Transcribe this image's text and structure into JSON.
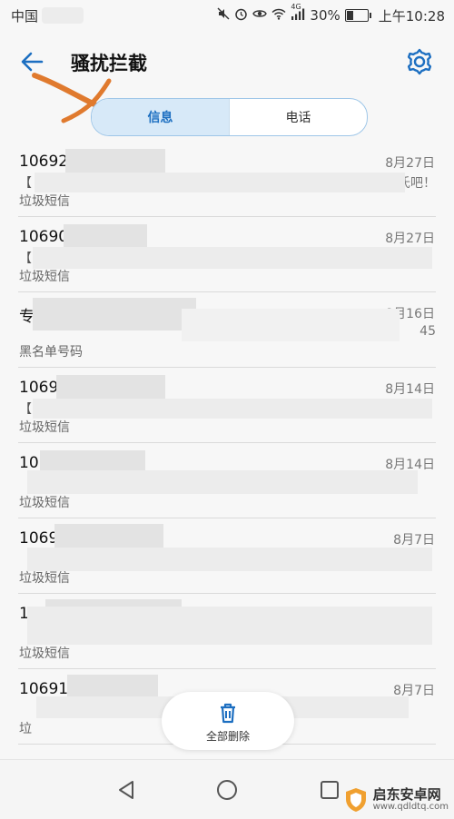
{
  "status_bar": {
    "carrier": "中国",
    "network": "4G",
    "battery_percent": "30%",
    "time": "上午10:28",
    "battery_level": 0.3
  },
  "app_bar": {
    "title": "骚扰拦截",
    "back_icon": "arrow-left-icon",
    "settings_icon": "gear-icon"
  },
  "tabs": [
    {
      "label": "信息",
      "selected": true
    },
    {
      "label": "电话",
      "selected": false
    }
  ],
  "messages": [
    {
      "sender": "10692",
      "date": "8月27日",
      "snippet": "【",
      "snippet_tail": "氏吧！",
      "category": "垃圾短信"
    },
    {
      "sender": "10690",
      "date": "8月27日",
      "snippet": "【",
      "snippet_tail": "",
      "category": "垃圾短信"
    },
    {
      "sender": "专",
      "date": "8月16日",
      "snippet": "",
      "snippet_tail": "45",
      "category": "黑名单号码"
    },
    {
      "sender": "1069",
      "date": "8月14日",
      "snippet": "【",
      "snippet_tail": "",
      "category": "垃圾短信"
    },
    {
      "sender": "10",
      "date": "8月14日",
      "snippet": "",
      "snippet_tail": "",
      "category": "垃圾短信"
    },
    {
      "sender": "1069",
      "date": "8月7日",
      "snippet": "",
      "snippet_tail": "",
      "category": "垃圾短信"
    },
    {
      "sender": "106",
      "date": "",
      "snippet": "",
      "snippet_tail": "",
      "category": "垃圾短信"
    },
    {
      "sender": "106910",
      "date": "8月7日",
      "snippet": "",
      "snippet_tail": "",
      "category": "垃"
    }
  ],
  "bottom_action": {
    "label": "全部删除",
    "icon": "trash-icon"
  },
  "nav_bar": {
    "back_icon": "triangle-back-icon",
    "home_icon": "circle-home-icon",
    "recents_icon": "square-recents-icon"
  },
  "watermark": {
    "title": "启东安卓网",
    "url": "www.qdldtq.com"
  },
  "colors": {
    "accent": "#1d6fc1",
    "tab_selected_bg": "#d7e9f8",
    "annotation_stroke": "#e07a2e"
  }
}
